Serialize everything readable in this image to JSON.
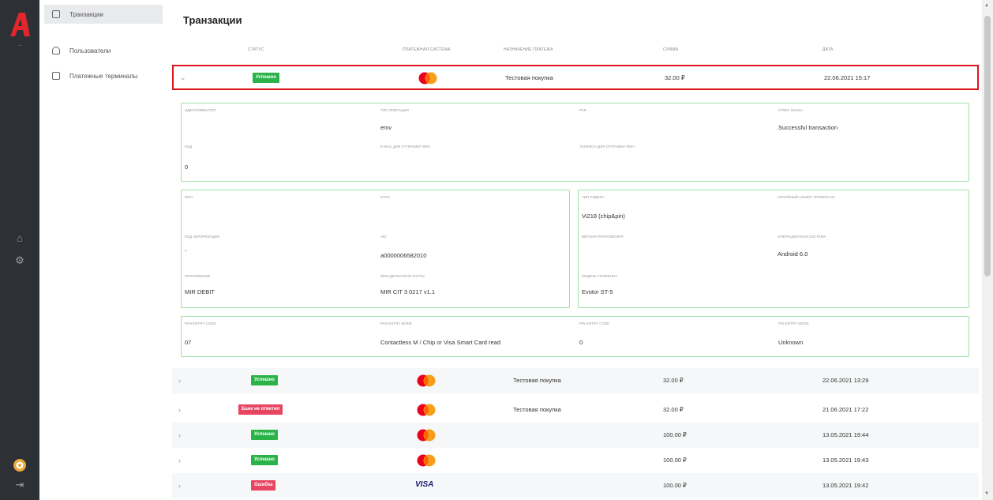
{
  "sidebar": {
    "items": [
      {
        "label": "Транзакции",
        "icon": "document-icon"
      },
      {
        "label": "Пользователи",
        "icon": "users-icon"
      },
      {
        "label": "Платежные терминалы",
        "icon": "terminal-icon"
      }
    ]
  },
  "page": {
    "title": "Транзакции"
  },
  "columns": [
    "Статус",
    "Платежная система",
    "Назначение платежа",
    "Сумма",
    "Дата"
  ],
  "selected_row": {
    "status": "Успешно",
    "payment_system": "mastercard",
    "purpose": "Тестовая покупка",
    "amount": "32.00 ₽",
    "date": "22.06.2021 15:17"
  },
  "details": {
    "box1": {
      "f1_label": "Идентификатор",
      "f1_value": "",
      "f2_label": "Тип операции",
      "f2_value": "emv",
      "f3_label": "PAN",
      "f3_value": "",
      "f4_label": "Ответ банка",
      "f4_value": "Successful transaction",
      "f5_label": "Код",
      "f5_value": "0",
      "f6_label": "E-mail для отправки чека",
      "f6_value": "",
      "f7_label": "Телефон для отправки чека",
      "f7_value": ""
    },
    "box2": {
      "f1_label": "RRN",
      "f1_value": "",
      "f2_label": "STAN",
      "f2_value": "",
      "f3_label": "Код авторизации",
      "f3_value": "-",
      "f4_label": "AID",
      "f4_value": "a0000006582010",
      "f5_label": "Приложение",
      "f5_value": "MIR DEBIT",
      "f6_label": "Имя держателя карты",
      "f6_value": "MIR CIT 3 0217 v1.1"
    },
    "box3": {
      "f1_label": "Тип ридера",
      "f1_value": "Vi218 (chip&pin)",
      "f2_label": "Серийный номер терминала",
      "f2_value": "",
      "f3_label": "Версия приложения",
      "f3_value": "",
      "f4_label": "Операционная система",
      "f4_value": "Android 6.0",
      "f5_label": "Модель телефона",
      "f5_value": "Evotor ST-5"
    },
    "box4": {
      "f1_label": "PAN entry code",
      "f1_value": "07",
      "f2_label": "PAN entry mode",
      "f2_value": "Contactless M / Chip or Visa Smart Card read",
      "f3_label": "PIN entry code",
      "f3_value": "0",
      "f4_label": "PIN entry mode",
      "f4_value": "Unknown"
    }
  },
  "rows": [
    {
      "status": "Успешно",
      "status_type": "ok",
      "payment_system": "mastercard",
      "purpose": "Тестовая покупка",
      "amount": "32.00 ₽",
      "date": "22.06.2021 13:29"
    },
    {
      "status": "Банк не ответил",
      "status_type": "bad",
      "payment_system": "mastercard",
      "purpose": "Тестовая покупка",
      "amount": "32.00 ₽",
      "date": "21.06.2021 17:22"
    },
    {
      "status": "Успешно",
      "status_type": "ok",
      "payment_system": "mastercard",
      "purpose": "",
      "amount": "100.00 ₽",
      "date": "13.05.2021 19:44"
    },
    {
      "status": "Успешно",
      "status_type": "ok",
      "payment_system": "mastercard",
      "purpose": "",
      "amount": "100.00 ₽",
      "date": "13.05.2021 19:43"
    },
    {
      "status": "Ошибка",
      "status_type": "bad",
      "payment_system": "visa",
      "purpose": "",
      "amount": "100.00 ₽",
      "date": "13.05.2021 19:42"
    }
  ],
  "brand": {
    "visa_text": "VISA"
  },
  "colors": {
    "success": "#2bb34a",
    "error": "#e84560",
    "highlight": "#e0141c",
    "detail_border": "#9fe1a8",
    "rail": "#2d3135"
  }
}
